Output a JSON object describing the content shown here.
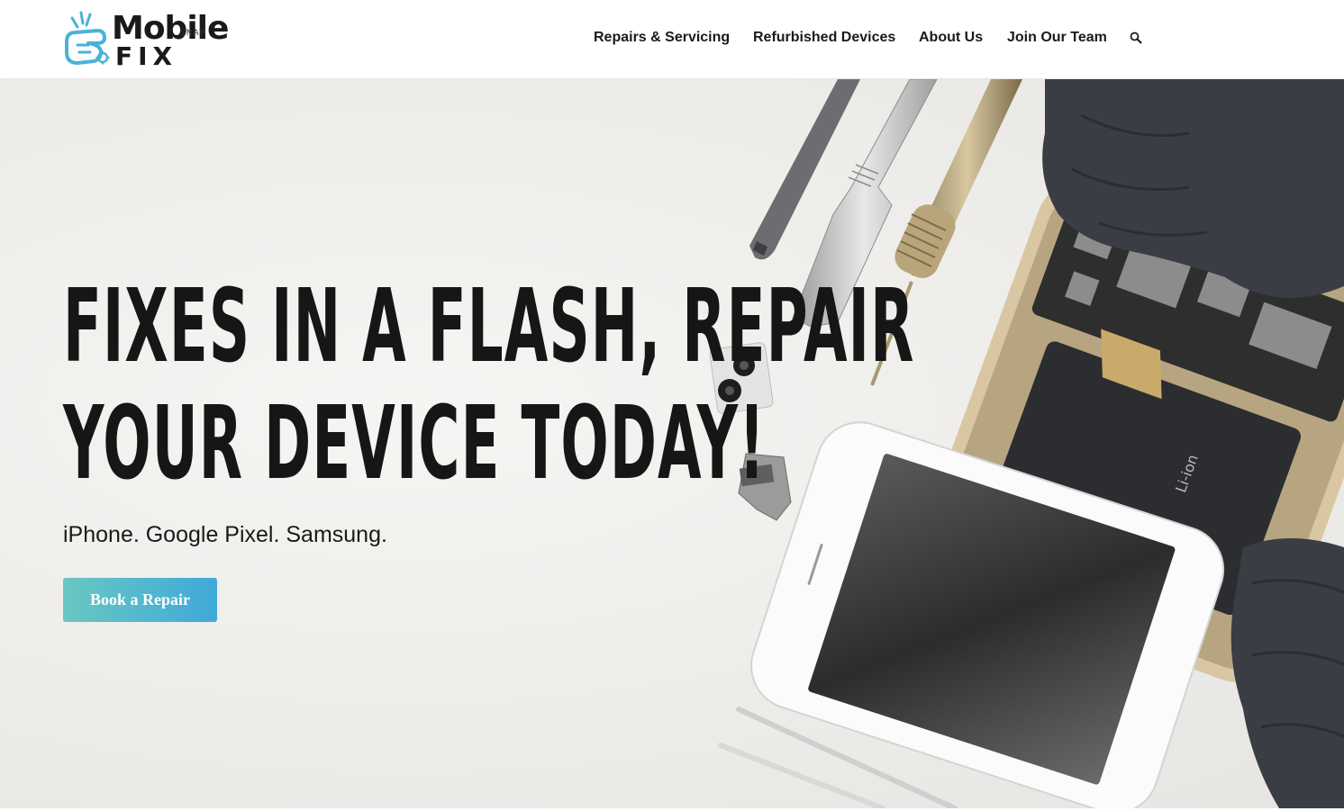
{
  "brand": {
    "word1": "Mobile",
    "snap": "SNAP",
    "word2": "FIX",
    "colors": {
      "accent": "#49b3d6",
      "dark": "#1a1a1a"
    }
  },
  "nav": {
    "items": [
      {
        "label": "Repairs & Servicing"
      },
      {
        "label": "Refurbished Devices"
      },
      {
        "label": "About Us"
      },
      {
        "label": "Join Our Team"
      }
    ],
    "search_icon": "search-icon"
  },
  "hero": {
    "title_line1": "FIXES IN A FLASH, REPAIR",
    "title_line2": "YOUR DEVICE TODAY!",
    "subtitle": "iPhone. Google Pixel. Samsung.",
    "cta_label": "Book a Repair",
    "cta_colors": [
      "#69c7c2",
      "#3fa9d9"
    ]
  }
}
